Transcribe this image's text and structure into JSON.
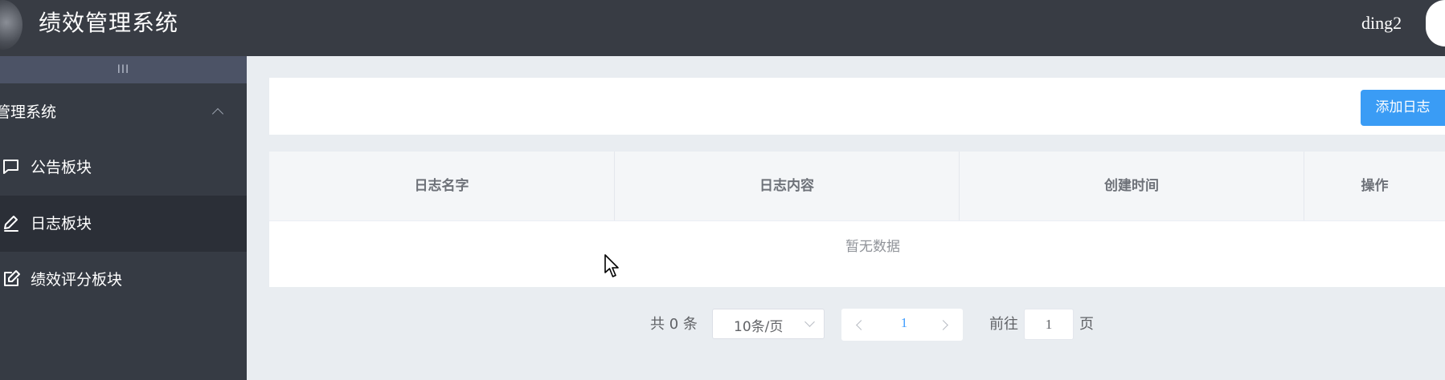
{
  "header": {
    "title": "绩效管理系统",
    "username": "ding2"
  },
  "sidebar": {
    "collapse_label": "III",
    "group_title": "管理系统",
    "items": [
      {
        "label": "公告板块",
        "icon": "message-square-icon"
      },
      {
        "label": "日志板块",
        "icon": "pen-icon",
        "active": true
      },
      {
        "label": "绩效评分板块",
        "icon": "edit-icon"
      }
    ]
  },
  "toolbar": {
    "add_label": "添加日志"
  },
  "table": {
    "columns": [
      "日志名字",
      "日志内容",
      "创建时间",
      "操作"
    ],
    "empty_text": "暂无数据"
  },
  "pagination": {
    "total_text": "共 0 条",
    "page_size": "10条/页",
    "current_page": "1",
    "goto_label": "前往",
    "goto_value": "1",
    "page_unit": "页"
  },
  "colors": {
    "header_bg": "#383c44",
    "sidebar_bg": "#363b44",
    "active_item_bg": "#2b2f37",
    "primary": "#3a9cf5"
  }
}
